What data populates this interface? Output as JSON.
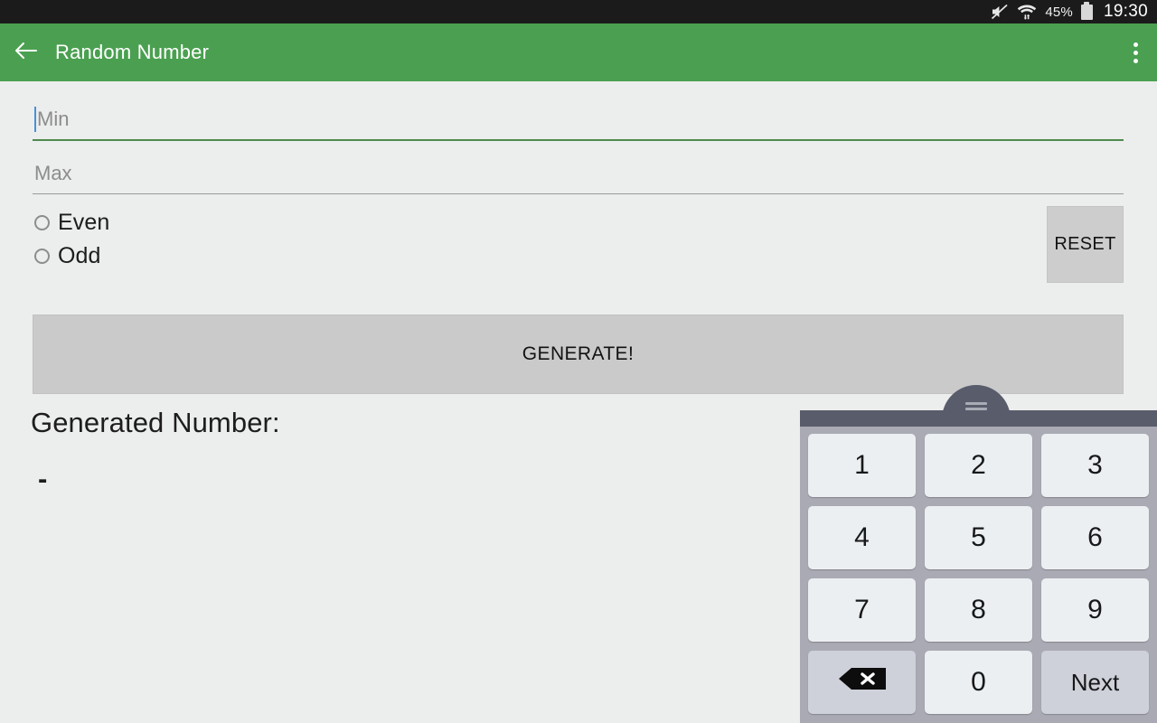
{
  "status_bar": {
    "icons": [
      "volume-mute-icon",
      "wifi-icon"
    ],
    "battery_percent": "45%",
    "clock": "19:30"
  },
  "app_bar": {
    "back_icon": "arrow-back-icon",
    "title": "Random Number",
    "overflow_icon": "overflow-menu-icon"
  },
  "form": {
    "min_field": {
      "placeholder": "Min",
      "value": "",
      "focused": true,
      "underline_color": "#4f8a4f"
    },
    "max_field": {
      "placeholder": "Max",
      "value": "",
      "focused": false,
      "underline_color": "#9a9a9a"
    },
    "radios": [
      {
        "label": "Even",
        "checked": false
      },
      {
        "label": "Odd",
        "checked": false
      }
    ],
    "reset_label": "RESET",
    "generate_label": "GENERATE!"
  },
  "result": {
    "label": "Generated Number:",
    "value": "-"
  },
  "keyboard": {
    "handle_icon": "drag-handle-icon",
    "keys": [
      {
        "label": "1",
        "name": "key-1",
        "style": "number"
      },
      {
        "label": "2",
        "name": "key-2",
        "style": "number"
      },
      {
        "label": "3",
        "name": "key-3",
        "style": "number"
      },
      {
        "label": "4",
        "name": "key-4",
        "style": "number"
      },
      {
        "label": "5",
        "name": "key-5",
        "style": "number"
      },
      {
        "label": "6",
        "name": "key-6",
        "style": "number"
      },
      {
        "label": "7",
        "name": "key-7",
        "style": "number"
      },
      {
        "label": "8",
        "name": "key-8",
        "style": "number"
      },
      {
        "label": "9",
        "name": "key-9",
        "style": "number"
      },
      {
        "label": "",
        "name": "key-backspace",
        "style": "backspace"
      },
      {
        "label": "0",
        "name": "key-0",
        "style": "number"
      },
      {
        "label": "Next",
        "name": "key-next",
        "style": "alt"
      }
    ]
  },
  "colors": {
    "app_bar_green": "#4aa050",
    "page_background": "#eceded",
    "keyboard_body": "#a9aab4",
    "keyboard_topbar": "#585c6b",
    "key_face": "#eceff1",
    "key_alt_face": "#cfd1da",
    "cursor_blue": "#4a90d9"
  }
}
